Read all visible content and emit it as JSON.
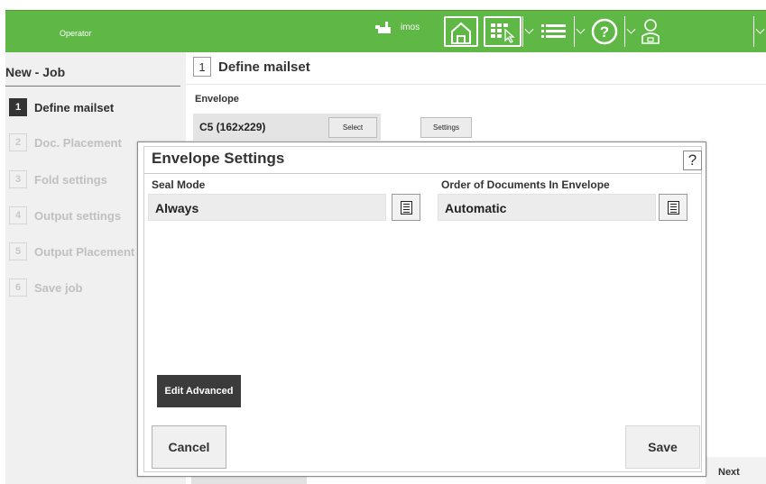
{
  "topbar": {
    "site_label": "imos",
    "operator_label": "Operator",
    "icons": [
      "home-icon",
      "apps-icon",
      "list-icon",
      "help-icon",
      "user-icon"
    ]
  },
  "sidebar": {
    "title": "New - Job",
    "steps": [
      {
        "num": "1",
        "label": "Define mailset",
        "active": true
      },
      {
        "num": "2",
        "label": "Doc. Placement",
        "active": false
      },
      {
        "num": "3",
        "label": "Fold settings",
        "active": false
      },
      {
        "num": "4",
        "label": "Output settings",
        "active": false
      },
      {
        "num": "5",
        "label": "Output Placement",
        "active": false
      },
      {
        "num": "6",
        "label": "Save job",
        "active": false
      }
    ]
  },
  "main": {
    "step_num": "1",
    "step_title": "Define mailset",
    "envelope_label": "Envelope",
    "envelope_value": "C5 (162x229)",
    "select_label": "Select",
    "settings_label": "Settings",
    "next_label": "Next"
  },
  "modal": {
    "title": "Envelope Settings",
    "help": "?",
    "seal_mode_label": "Seal Mode",
    "seal_mode_value": "Always",
    "order_label": "Order of Documents In Envelope",
    "order_value": "Automatic",
    "edit_advanced_label": "Edit Advanced",
    "cancel_label": "Cancel",
    "save_label": "Save"
  },
  "colors": {
    "brand_green": "#5fb846",
    "dark_button": "#3b3b3b"
  }
}
